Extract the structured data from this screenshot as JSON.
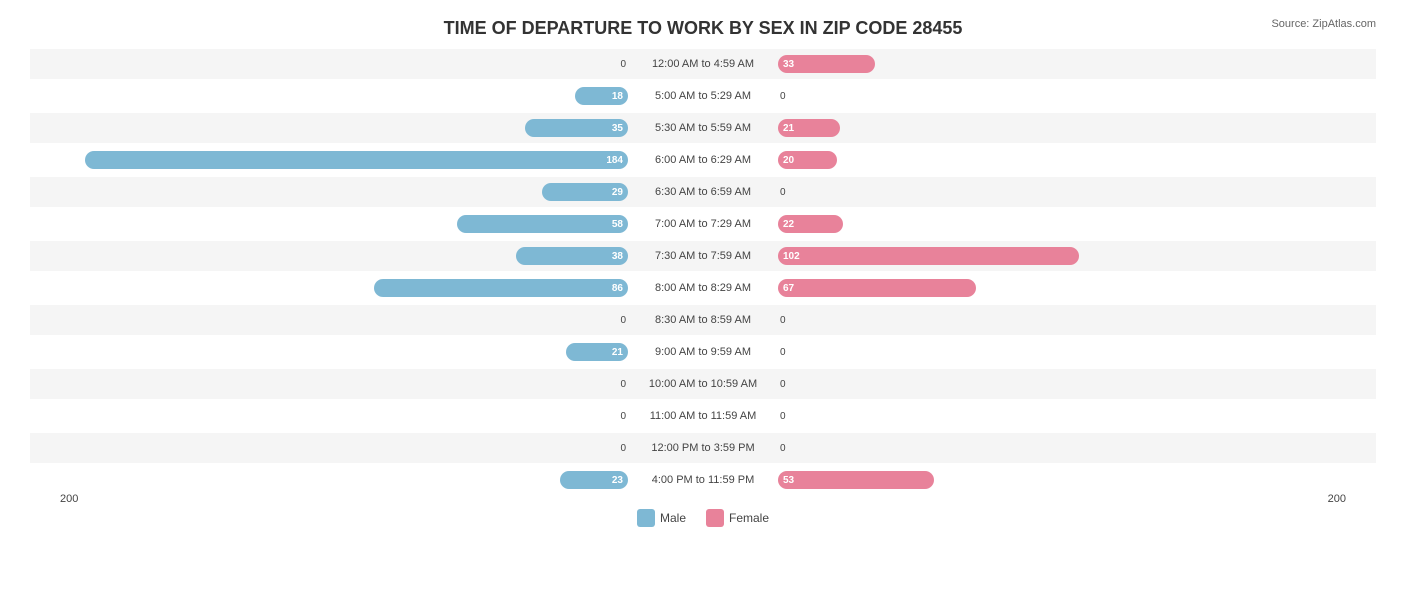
{
  "title": "TIME OF DEPARTURE TO WORK BY SEX IN ZIP CODE 28455",
  "source": "Source: ZipAtlas.com",
  "colors": {
    "male": "#7eb8d4",
    "female": "#e8829a"
  },
  "legend": {
    "male_label": "Male",
    "female_label": "Female"
  },
  "axis": {
    "left": "200",
    "right": "200"
  },
  "max_value": 200,
  "rows": [
    {
      "label": "12:00 AM to 4:59 AM",
      "male": 0,
      "female": 33
    },
    {
      "label": "5:00 AM to 5:29 AM",
      "male": 18,
      "female": 0
    },
    {
      "label": "5:30 AM to 5:59 AM",
      "male": 35,
      "female": 21
    },
    {
      "label": "6:00 AM to 6:29 AM",
      "male": 184,
      "female": 20
    },
    {
      "label": "6:30 AM to 6:59 AM",
      "male": 29,
      "female": 0
    },
    {
      "label": "7:00 AM to 7:29 AM",
      "male": 58,
      "female": 22
    },
    {
      "label": "7:30 AM to 7:59 AM",
      "male": 38,
      "female": 102
    },
    {
      "label": "8:00 AM to 8:29 AM",
      "male": 86,
      "female": 67
    },
    {
      "label": "8:30 AM to 8:59 AM",
      "male": 0,
      "female": 0
    },
    {
      "label": "9:00 AM to 9:59 AM",
      "male": 21,
      "female": 0
    },
    {
      "label": "10:00 AM to 10:59 AM",
      "male": 0,
      "female": 0
    },
    {
      "label": "11:00 AM to 11:59 AM",
      "male": 0,
      "female": 0
    },
    {
      "label": "12:00 PM to 3:59 PM",
      "male": 0,
      "female": 0
    },
    {
      "label": "4:00 PM to 11:59 PM",
      "male": 23,
      "female": 53
    }
  ]
}
